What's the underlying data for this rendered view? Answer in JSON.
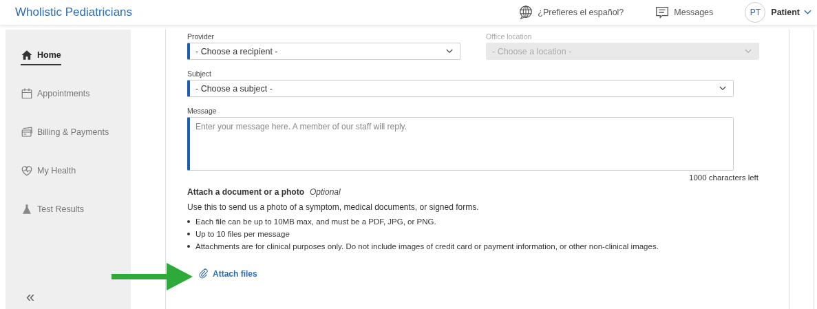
{
  "header": {
    "brand": "Wholistic Pediatricians",
    "language_link": "¿Prefieres el español?",
    "messages_link": "Messages",
    "user": {
      "initials": "PT",
      "name": "Patient"
    }
  },
  "sidebar": {
    "items": [
      {
        "label": "Home",
        "kind": "home",
        "selected": true
      },
      {
        "label": "Appointments",
        "kind": "calendar",
        "selected": false
      },
      {
        "label": "Billing & Payments",
        "kind": "card",
        "selected": false
      },
      {
        "label": "My Health",
        "kind": "heart",
        "selected": false
      },
      {
        "label": "Test Results",
        "kind": "flask",
        "selected": false
      }
    ],
    "collapse": "«"
  },
  "form": {
    "provider": {
      "label": "Provider",
      "value": "- Choose a recipient -",
      "disabled": false
    },
    "office_location": {
      "label": "Office location",
      "value": "- Choose a location -",
      "disabled": true
    },
    "subject": {
      "label": "Subject",
      "value": "- Choose a subject -",
      "disabled": false
    },
    "message": {
      "label": "Message",
      "placeholder": "Enter your message here. A member of our staff will reply.",
      "counter": "1000 characters left"
    },
    "attachments": {
      "heading": "Attach a document or a photo",
      "optional": "Optional",
      "intro": "Use this to send us a photo of a symptom, medical documents, or signed forms.",
      "rules": [
        "Each file can be up to 10MB max, and must be a PDF, JPG, or PNG.",
        "Up to 10 files per message",
        "Attachments are for clinical purposes only. Do not include images of credit card or payment information, or other non-clinical images."
      ],
      "link": "Attach files"
    }
  }
}
